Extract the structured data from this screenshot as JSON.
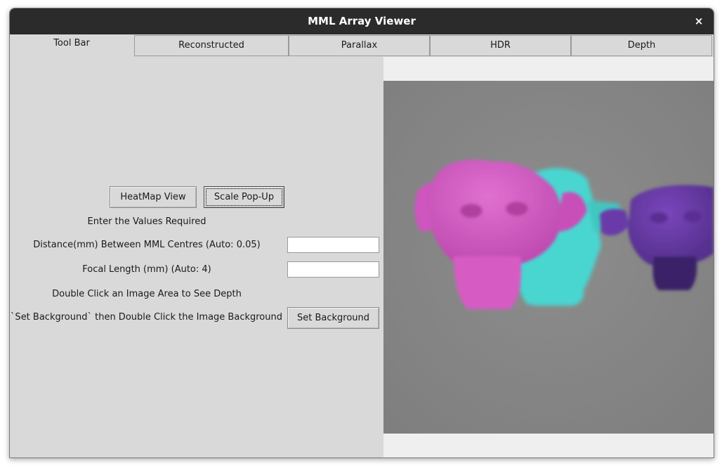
{
  "window": {
    "title": "MML Array Viewer",
    "close_symbol": "×"
  },
  "tabs": [
    {
      "label": "Tool Bar",
      "active": true
    },
    {
      "label": "Reconstructed",
      "active": false
    },
    {
      "label": "Parallax",
      "active": false
    },
    {
      "label": "HDR",
      "active": false
    },
    {
      "label": "Depth",
      "active": false
    }
  ],
  "toolbar": {
    "heatmap_button": "HeatMap View",
    "scale_button": "Scale Pop-Up",
    "prompt": "Enter the Values Required",
    "distance_label": "Distance(mm) Between MML Centres (Auto: 0.05)",
    "distance_value": "",
    "focal_label": "Focal Length (mm) (Auto: 4)",
    "focal_value": "",
    "depth_hint": "Double Click an Image Area to See Depth",
    "background_hint": "Click `Set Background` then Double Click the Image Background",
    "set_background_button": "Set Background"
  },
  "image": {
    "background_color": "#888888",
    "subjects": [
      {
        "name": "monkey-head",
        "color": "#d85ac6"
      },
      {
        "name": "monkey-head",
        "color": "#49d6d0"
      },
      {
        "name": "monkey-head",
        "color": "#6a3aa8"
      }
    ]
  }
}
